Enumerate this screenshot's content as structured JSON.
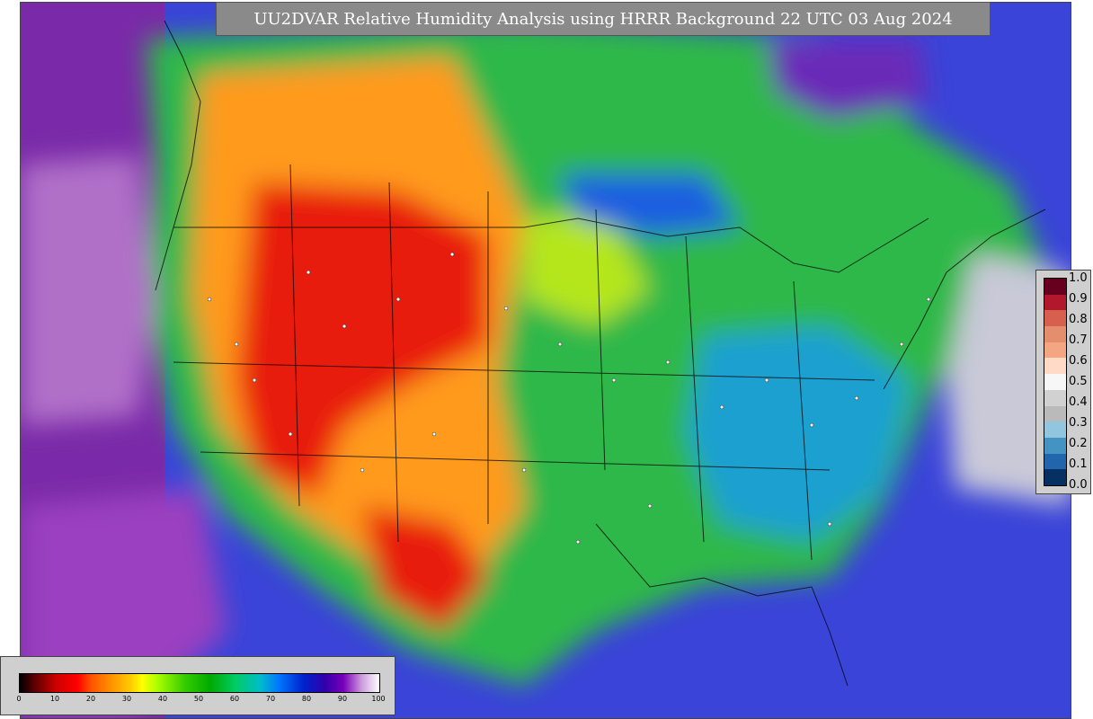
{
  "map": {
    "title": "UU2DVAR Relative Humidity Analysis using HRRR Background 22 UTC 03 Aug 2024"
  },
  "shading_legend": {
    "ticks": [
      "0",
      "10",
      "20",
      "30",
      "40",
      "50",
      "60",
      "70",
      "80",
      "90",
      "100"
    ]
  },
  "observation_colorbar": {
    "ticks": [
      "1.0",
      "0.9",
      "0.8",
      "0.7",
      "0.6",
      "0.5",
      "0.4",
      "0.3",
      "0.2",
      "0.1",
      "0.0"
    ],
    "colors": [
      "#67001f",
      "#b2182b",
      "#d6604d",
      "#e58e6e",
      "#f4a582",
      "#fddbc7",
      "#f7f7f7",
      "#d1d1d1",
      "#bababa",
      "#92c5de",
      "#4393c3",
      "#2166ac",
      "#053061"
    ]
  }
}
